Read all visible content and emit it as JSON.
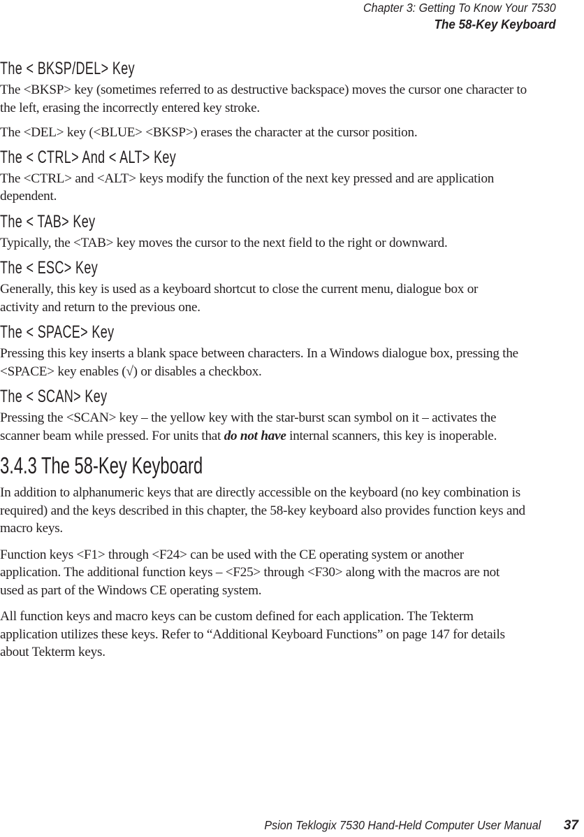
{
  "header": {
    "chapter": "Chapter  3:  Getting To Know Your 7530",
    "section": "The 58-Key Keyboard"
  },
  "sections": [
    {
      "heading": "The < BKSP/DEL>  Key",
      "paragraphs": [
        "The <BKSP> key (sometimes referred to as destructive backspace) moves the cursor one character to the left, erasing the incorrectly entered key stroke.",
        "The <DEL> key (<BLUE> <BKSP>) erases the character at the cursor position."
      ]
    },
    {
      "heading": "The < CTRL>  And < ALT>  Key",
      "paragraphs": [
        "The <CTRL> and <ALT> keys modify the function of the next key pressed and are application dependent."
      ]
    },
    {
      "heading": "The < TAB>  Key",
      "paragraphs": [
        "Typically, the <TAB> key moves the cursor to the next field to the right or downward."
      ]
    },
    {
      "heading": "The < ESC>  Key",
      "paragraphs": [
        "Generally, this key is used as a keyboard shortcut to close the current menu, dialogue box or activity and return to the previous one."
      ]
    },
    {
      "heading": "The < SPACE>  Key",
      "paragraphs": [
        "Pressing this key inserts a blank space between characters. In a Windows dialogue box, pressing the <SPACE> key enables (√) or disables a checkbox."
      ]
    },
    {
      "heading": "The < SCAN>  Key",
      "scan_paragraph": {
        "before": "Pressing the <SCAN> key – the yellow key with the star-burst scan symbol on it – activates the scanner beam while pressed. For units that ",
        "emphasis": "do not have",
        "after": " internal scanners, this key is inoperable."
      }
    }
  ],
  "subsection": {
    "heading": "3.4.3  The 58-Key Keyboard",
    "paragraphs": [
      "In addition to alphanumeric keys that are directly accessible on the keyboard (no key combination is required) and the keys described in this chapter, the 58-key keyboard also provides function keys and macro keys.",
      "Function keys <F1> through <F24> can be used with the CE operating system or another application. The additional function keys – <F25> through <F30> along with the macros are not used as part of the Windows CE operating system.",
      "All function keys and macro keys can be custom defined for each application. The Tekterm application utilizes these keys. Refer to “Additional Keyboard Functions” on page 147 for details about Tekterm keys."
    ]
  },
  "footer": {
    "manual_title": "Psion Teklogix 7530 Hand-Held Computer User Manual",
    "page_number": "37"
  }
}
